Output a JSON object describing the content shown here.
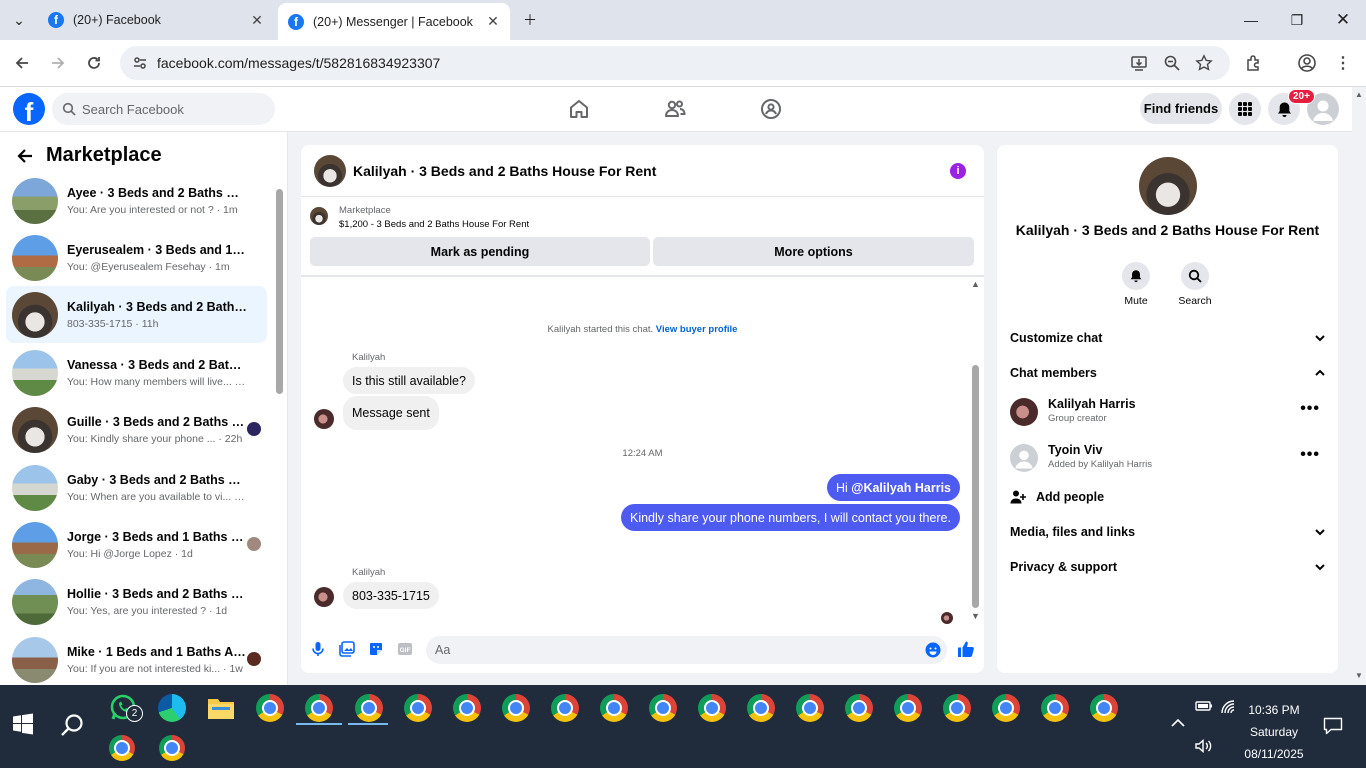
{
  "browser": {
    "tabs": [
      {
        "title": "(20+) Facebook"
      },
      {
        "title": "(20+) Messenger | Facebook"
      }
    ],
    "url": "facebook.com/messages/t/582816834923307"
  },
  "fb_header": {
    "search_placeholder": "Search Facebook",
    "find_friends": "Find friends",
    "notification_badge": "20+"
  },
  "sidebar": {
    "title": "Marketplace",
    "conversations": [
      {
        "name": "Ayee · 3 Beds and 2 Baths Hous...",
        "snippet": "You: Are you interested or not ? · 1m"
      },
      {
        "name": "Eyerusealem · 3 Beds and 1 Bath...",
        "snippet": "You: @Eyerusealem Fesehay · 1m"
      },
      {
        "name": "Kalilyah · 3 Beds and 2 Baths H...",
        "snippet": "803-335-1715 · 11h"
      },
      {
        "name": "Vanessa · 3 Beds and 2 Baths H...",
        "snippet": "You: How many members will live... · 22h"
      },
      {
        "name": "Guille · 3 Beds and 2 Baths H...",
        "snippet": "You: Kindly share your phone ... · 22h"
      },
      {
        "name": "Gaby · 3 Beds and 2 Baths Hous...",
        "snippet": "You: When are you available to vi... · 22h"
      },
      {
        "name": "Jorge · 3 Beds and 1 Baths Ho...",
        "snippet": "You: Hi @Jorge Lopez · 1d"
      },
      {
        "name": "Hollie · 3 Beds and 2 Baths Hou...",
        "snippet": "You: Yes, are you interested ? · 1d"
      },
      {
        "name": "Mike · 1 Beds and 1 Baths Ap...",
        "snippet": "You: If you are not interested ki... · 1w"
      }
    ]
  },
  "chat": {
    "title": "Kalilyah · 3 Beds and 2 Baths House For Rent",
    "marketplace_label": "Marketplace",
    "listing": "$1,200 - 3 Beds and 2 Baths House For Rent",
    "mark_pending": "Mark as pending",
    "more_options": "More options",
    "started_text": "Kalilyah started this chat.",
    "view_buyer": "View buyer profile",
    "sender_name": "Kalilyah",
    "msg1": "Is this still available?",
    "msg2": "Message sent",
    "time_sep": "12:24 AM",
    "out1_prefix": "Hi ",
    "out1_mention": "@Kalilyah Harris",
    "out2": "Kindly share your phone numbers, I will contact you there.",
    "sender_name2": "Kalilyah",
    "msg3": "803-335-1715",
    "composer_placeholder": "Aa"
  },
  "right_panel": {
    "title": "Kalilyah · 3 Beds and 2 Baths House For Rent",
    "mute": "Mute",
    "search": "Search",
    "customize": "Customize chat",
    "members_section": "Chat members",
    "members": [
      {
        "name": "Kalilyah Harris",
        "role": "Group creator"
      },
      {
        "name": "Tyoin Viv",
        "role": "Added by Kalilyah Harris"
      }
    ],
    "add_people": "Add people",
    "media": "Media, files and links",
    "privacy": "Privacy & support"
  },
  "taskbar": {
    "whatsapp_badge": "2",
    "time": "10:36 PM",
    "day": "Saturday",
    "date": "08/11/2025"
  },
  "colors": {
    "fb_blue": "#0866ff",
    "bubble_out": "#4e5bf0",
    "active_conv": "#ebf5ff"
  }
}
